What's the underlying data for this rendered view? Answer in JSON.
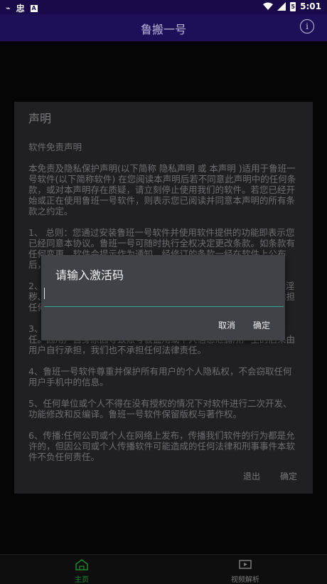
{
  "status": {
    "time": "5:01",
    "sim_label": "忠",
    "battery_level": "5"
  },
  "appbar": {
    "title": "鲁搬一号",
    "info_glyph": "i"
  },
  "declaration": {
    "title": "声明",
    "body": "软件免责声明\n\n本免责及隐私保护声明(以下简称 隐私声明 或 本声明 )适用于鲁班一号软件(以下简称软件) 在您阅读本声明后若不同意此声明中的任何条款，或对本声明存在质疑，请立刻停止使用我们的软件。若您已经开始或正在使用鲁班一号软件，则表示您已阅读并同意本声明的所有条款之约定。\n\n1、 总则：您通过安装鲁班一号软件并使用软件提供的功能即表示您已经同意本协议。鲁班一号可随时执行全权决定更改条款。如条款有任何变更，软件会提示作为通知。经修订的条款一经在软件上公布后，立即自动生效。\n\n2、 本软件所提供的信息仅供参考，不得用于商业用途，不得传播淫秽、诽谤、反动等违法内容，否则一切后果由您自行承担。亦不承担任何法律责任。\n\n3、 用户因使用本软件而产生的任何损失，我们不承担任何法律责任。因用户自身原因导致账号被盗用或个人信息泄露所产生的后果由用户自行承担，我们也不承担任何法律责任。\n\n4、鲁班一号软件尊重并保护所有用户的个人隐私权，不会窃取任何用户手机中的信息。\n\n5、任何单位或个人不得在没有授权的情况下对软件进行二次开发、功能修改和反编译。鲁班一号软件保留版权与著作权。\n\n6、传播:任何公司或个人在网络上发布，传播我们软件的行为都是允许的，但因公司或个人传播软件可能造成的任何法律和刑事事件本软件不负任何责任。",
    "exit_label": "退出",
    "confirm_label": "确定"
  },
  "modal": {
    "title": "请输入激活码",
    "input_value": "",
    "cancel_label": "取消",
    "confirm_label": "确定"
  },
  "nav": {
    "home_label": "主页",
    "video_label": "视频解析"
  },
  "colors": {
    "appbar": "#1f0f58",
    "accent": "#2aa89a",
    "home_active": "#1c8a2c"
  }
}
